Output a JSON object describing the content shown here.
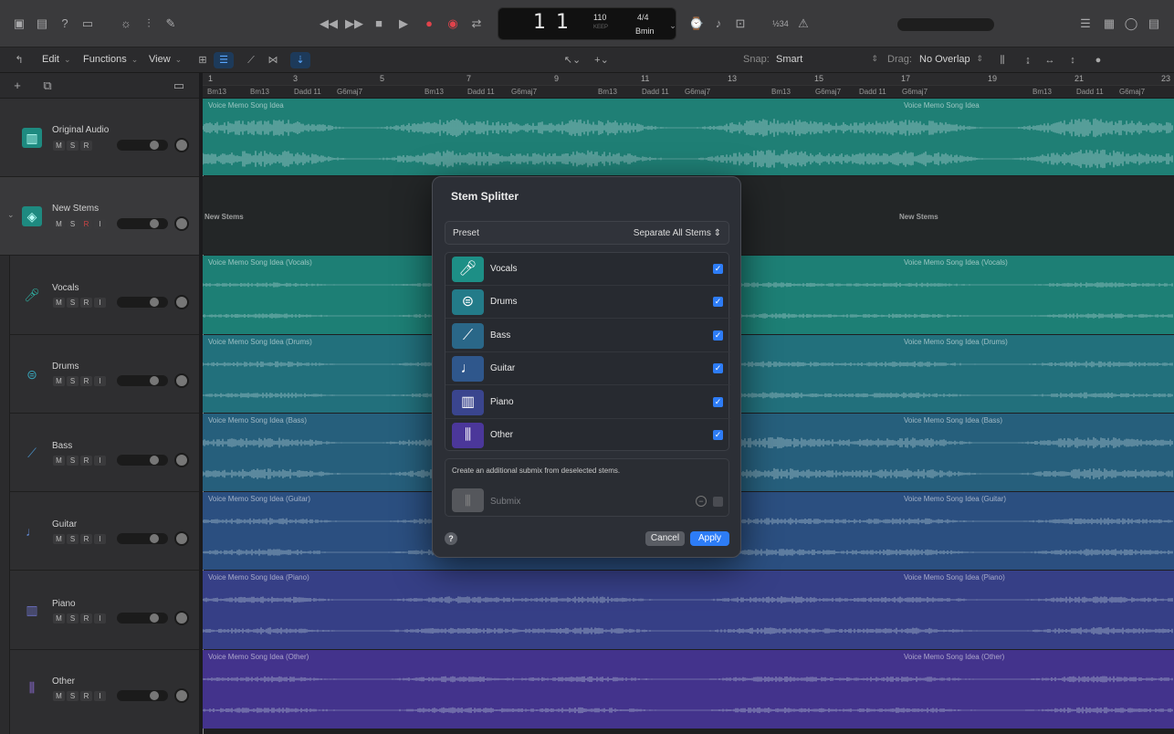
{
  "transport": {
    "bar": "1",
    "beat": "1",
    "tempo": "110",
    "tempo_mode": "KEEP",
    "time_signature": "4/4",
    "key": "Bmin",
    "tuner_label": "½34"
  },
  "toolbar": {
    "edit": "Edit",
    "functions": "Functions",
    "view": "View",
    "snap_label": "Snap:",
    "snap_value": "Smart",
    "drag_label": "Drag:",
    "drag_value": "No Overlap"
  },
  "ruler": {
    "bars": [
      "1",
      "3",
      "5",
      "7",
      "9",
      "11",
      "13",
      "15",
      "17",
      "19",
      "21",
      "23"
    ]
  },
  "chords": [
    "Bm13",
    "Bm13",
    "Dadd 11",
    "G6maj7",
    "Bm13",
    "Dadd 11",
    "G6maj7",
    "Bm13",
    "Dadd 11",
    "G6maj7",
    "Bm13",
    "G6maj7",
    "Dadd 11",
    "G6maj7",
    "Bm13",
    "Dadd 11",
    "G6maj7"
  ],
  "tracks": [
    {
      "name": "Original Audio",
      "icon": "waveform-icon",
      "color": "#1e8a80"
    },
    {
      "name": "New Stems",
      "icon": "stack-icon",
      "color": "#1e8a80"
    },
    {
      "name": "Vocals",
      "icon": "microphone-icon",
      "color": "#1e8a80"
    },
    {
      "name": "Drums",
      "icon": "drum-kit-icon",
      "color": "#23707e"
    },
    {
      "name": "Bass",
      "icon": "bass-guitar-icon",
      "color": "#28607e"
    },
    {
      "name": "Guitar",
      "icon": "guitar-icon",
      "color": "#2e5283"
    },
    {
      "name": "Piano",
      "icon": "piano-icon",
      "color": "#3b4187"
    },
    {
      "name": "Other",
      "icon": "waveform-icon",
      "color": "#4b3591"
    }
  ],
  "msr": {
    "m": "M",
    "s": "S",
    "r": "R",
    "i": "I"
  },
  "regions": {
    "original": "Voice Memo Song Idea",
    "stems_folder": "New Stems",
    "vocals": "Voice Memo Song Idea (Vocals)",
    "drums": "Voice Memo Song Idea (Drums)",
    "bass": "Voice Memo Song Idea (Bass)",
    "guitar": "Voice Memo Song Idea (Guitar)",
    "piano": "Voice Memo Song Idea (Piano)",
    "other": "Voice Memo Song Idea (Other)"
  },
  "dialog": {
    "title": "Stem Splitter",
    "preset_label": "Preset",
    "preset_value": "Separate All Stems",
    "stems": [
      {
        "label": "Vocals",
        "checked": true,
        "color": "#1d8f86"
      },
      {
        "label": "Drums",
        "checked": true,
        "color": "#237b89"
      },
      {
        "label": "Bass",
        "checked": true,
        "color": "#2a6788"
      },
      {
        "label": "Guitar",
        "checked": true,
        "color": "#2f578c"
      },
      {
        "label": "Piano",
        "checked": true,
        "color": "#3a458e"
      },
      {
        "label": "Other",
        "checked": true,
        "color": "#4b379a"
      }
    ],
    "submix_desc": "Create an additional submix from deselected stems.",
    "submix_label": "Submix",
    "help": "?",
    "cancel": "Cancel",
    "apply": "Apply"
  }
}
